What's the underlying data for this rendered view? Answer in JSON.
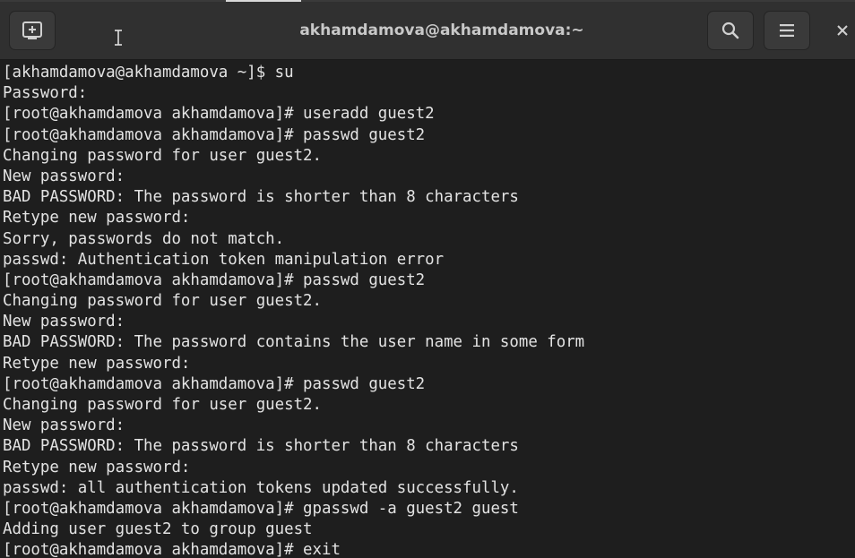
{
  "window": {
    "title": "akhamdamova@akhamdamova:~"
  },
  "header": {
    "new_tab_icon": "new-tab-icon",
    "search_icon": "search-icon",
    "menu_icon": "hamburger-menu-icon",
    "close_icon": "close-icon",
    "cursor_icon": "text-cursor-icon"
  },
  "terminal": {
    "lines": [
      "[akhamdamova@akhamdamova ~]$ su",
      "Password:",
      "[root@akhamdamova akhamdamova]# useradd guest2",
      "[root@akhamdamova akhamdamova]# passwd guest2",
      "Changing password for user guest2.",
      "New password:",
      "BAD PASSWORD: The password is shorter than 8 characters",
      "Retype new password:",
      "Sorry, passwords do not match.",
      "passwd: Authentication token manipulation error",
      "[root@akhamdamova akhamdamova]# passwd guest2",
      "Changing password for user guest2.",
      "New password:",
      "BAD PASSWORD: The password contains the user name in some form",
      "Retype new password:",
      "[root@akhamdamova akhamdamova]# passwd guest2",
      "Changing password for user guest2.",
      "New password:",
      "BAD PASSWORD: The password is shorter than 8 characters",
      "Retype new password:",
      "passwd: all authentication tokens updated successfully.",
      "[root@akhamdamova akhamdamova]# gpasswd -a guest2 guest",
      "Adding user guest2 to group guest",
      "[root@akhamdamova akhamdamova]# exit"
    ]
  },
  "colors": {
    "background": "#1e1e1e",
    "titlebar": "#303030",
    "text": "#e3e3e3",
    "title_text": "#c8c8c8"
  }
}
